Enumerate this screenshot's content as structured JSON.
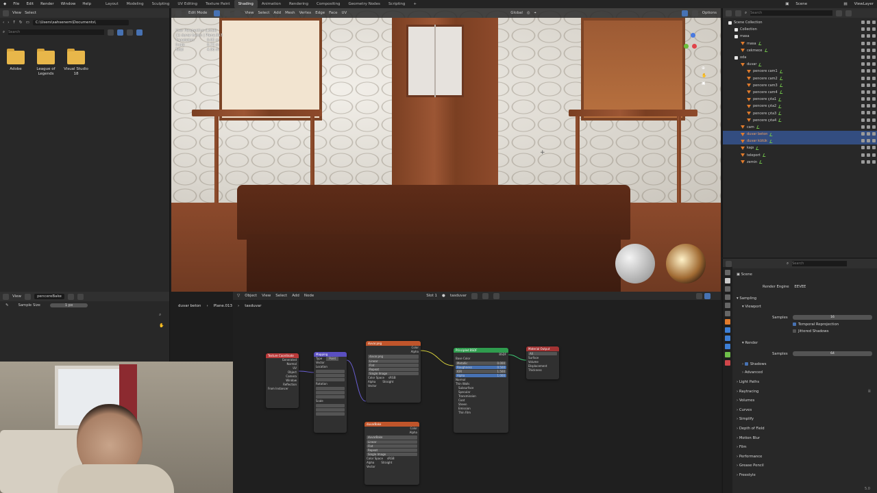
{
  "topbar": {
    "menus": [
      "File",
      "Edit",
      "Render",
      "Window",
      "Help"
    ],
    "workspaces": [
      "Layout",
      "Modeling",
      "Sculpting",
      "UV Editing",
      "Texture Paint",
      "Shading",
      "Animation",
      "Rendering",
      "Compositing",
      "Geometry Nodes",
      "Scripting"
    ],
    "active_workspace": "Shading",
    "scene": "Scene",
    "view_layer": "ViewLayer"
  },
  "filebrowser": {
    "view_label": "View",
    "select_label": "Select",
    "path": "C:\\Users\\sahsenem\\Documents\\",
    "search_placeholder": "Search",
    "folders": [
      "Adobe",
      "League of Legends",
      "Visual Studio 18"
    ]
  },
  "viewport": {
    "mode": "Edit Mode",
    "menus": [
      "View",
      "Select",
      "Add",
      "Mesh",
      "Vertex",
      "Edge",
      "Face",
      "UV"
    ],
    "transform": "Global",
    "options": "Options",
    "stats": [
      {
        "label": "User Perspective (Local)",
        "value": ""
      },
      {
        "label": "(1) duvar beton | Plane.013",
        "value": ""
      },
      {
        "label": "Translation",
        "value": "0.05 m"
      },
      {
        "label": "Scale",
        "value": "0.72 m"
      },
      {
        "label": "Total",
        "value": "4.06 m"
      }
    ]
  },
  "toolpanel": {
    "view_label": "View",
    "image_name": "pencereBake",
    "sample_size_label": "Sample Size",
    "sample_size_value": "1 px"
  },
  "node_editor": {
    "type_label": "Object",
    "menus": [
      "View",
      "Select",
      "Add",
      "Node"
    ],
    "slot": "Slot 1",
    "material": "tasduvar",
    "breadcrumb": [
      "duvar beton",
      "Plane.013",
      "tasduvar"
    ],
    "nodes": {
      "texcoord": {
        "title": "Texture Coordinate",
        "outputs": [
          "Generated",
          "Normal",
          "UV",
          "Object",
          "Camera",
          "Window",
          "Reflection"
        ],
        "footer": "From Instancer"
      },
      "mapping": {
        "title": "Mapping",
        "type_label": "Type",
        "type_value": "Point",
        "rows": [
          "Vector",
          "Location",
          "Rotation",
          "Scale"
        ]
      },
      "image1": {
        "title": "duvar.png",
        "image": "duvar.png",
        "rows": [
          "Linear",
          "Flat",
          "Repeat",
          "Single Image"
        ],
        "color_space_label": "Color Space",
        "color_space_value": "sRGB",
        "alpha_label": "Alpha",
        "alpha_value": "Straight",
        "outputs": [
          "Color",
          "Alpha"
        ],
        "input": "Vector"
      },
      "image2": {
        "title": "duvarBake",
        "image": "duvarBake",
        "rows": [
          "Linear",
          "Flat",
          "Repeat",
          "Single Image"
        ],
        "color_space_label": "Color Space",
        "color_space_value": "sRGB",
        "alpha_label": "Alpha",
        "alpha_value": "Straight",
        "outputs": [
          "Color",
          "Alpha"
        ],
        "input": "Vector"
      },
      "bsdf": {
        "title": "Principled BSDF",
        "output": "BSDF",
        "rows": [
          "Base Color",
          "Metallic",
          "Roughness",
          "IOR",
          "Alpha",
          "Normal",
          "Thin Walls",
          "Subsurface",
          "Specular",
          "Transmission",
          "Coat",
          "Sheen",
          "Emission",
          "Thin Film"
        ],
        "values": [
          "0.000",
          "0.500",
          "1.500",
          "1.000"
        ]
      },
      "output": {
        "title": "Material Output",
        "target": "All",
        "rows": [
          "Surface",
          "Volume",
          "Displacement",
          "Thickness"
        ]
      }
    }
  },
  "outliner": {
    "search_placeholder": "Search",
    "items": [
      {
        "name": "Scene Collection",
        "indent": 0,
        "kind": "scene"
      },
      {
        "name": "Collection",
        "indent": 1,
        "kind": "collection"
      },
      {
        "name": "masa",
        "indent": 1,
        "kind": "collection"
      },
      {
        "name": "masa",
        "indent": 2,
        "kind": "object"
      },
      {
        "name": "cekmece",
        "indent": 2,
        "kind": "object"
      },
      {
        "name": "oda",
        "indent": 1,
        "kind": "collection"
      },
      {
        "name": "duvar",
        "indent": 2,
        "kind": "object"
      },
      {
        "name": "pencere cam1",
        "indent": 3,
        "kind": "object"
      },
      {
        "name": "pencere cam2",
        "indent": 3,
        "kind": "object"
      },
      {
        "name": "pencere cam3",
        "indent": 3,
        "kind": "object"
      },
      {
        "name": "pencere cam4",
        "indent": 3,
        "kind": "object"
      },
      {
        "name": "pencere çıta1",
        "indent": 3,
        "kind": "object"
      },
      {
        "name": "pencere çıta2",
        "indent": 3,
        "kind": "object"
      },
      {
        "name": "pencere çıta3",
        "indent": 3,
        "kind": "object"
      },
      {
        "name": "pencere çıta4",
        "indent": 3,
        "kind": "object"
      },
      {
        "name": "cam",
        "indent": 2,
        "kind": "object"
      },
      {
        "name": "duvar beton",
        "indent": 2,
        "kind": "object",
        "selected": true
      },
      {
        "name": "duvar kütük",
        "indent": 2,
        "kind": "object",
        "selected": true
      },
      {
        "name": "kapı",
        "indent": 2,
        "kind": "object"
      },
      {
        "name": "teleport",
        "indent": 2,
        "kind": "object"
      },
      {
        "name": "zemin",
        "indent": 2,
        "kind": "object"
      }
    ]
  },
  "properties": {
    "search_placeholder": "Search",
    "context": "Scene",
    "render_engine_label": "Render Engine",
    "render_engine_value": "EEVEE",
    "sampling": "Sampling",
    "viewport": "Viewport",
    "samples_label": "Samples",
    "viewport_samples": "16",
    "temporal_reprojection": "Temporal Reprojection",
    "jittered_shadows": "Jittered Shadows",
    "render": "Render",
    "render_samples": "64",
    "shadows": "Shadows",
    "advanced": "Advanced",
    "panels": [
      "Light Paths",
      "Raytracing",
      "Volumes",
      "Curves",
      "Simplify",
      "Depth of Field",
      "Motion Blur",
      "Film",
      "Performance",
      "Grease Pencil",
      "Freestyle"
    ]
  },
  "statusbar": {
    "version": "5.0"
  },
  "colors": {
    "accent": "#4772b3",
    "selection": "#334d80",
    "texture_node": "#c0552b",
    "shader_node": "#2f9c4e",
    "vector_node": "#5a4fc0",
    "input_node": "#b93a3a",
    "output_node": "#a33333"
  }
}
